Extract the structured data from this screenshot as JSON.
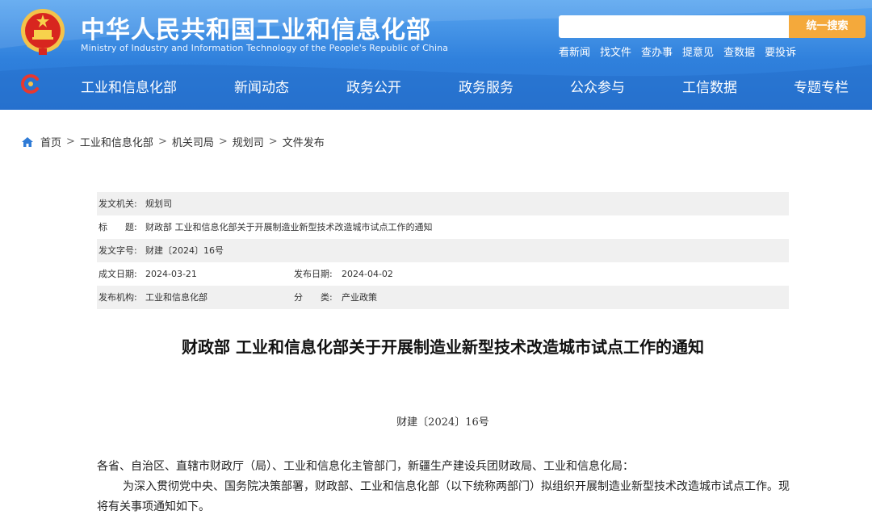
{
  "header": {
    "site_name": "中华人民共和国工业和信息化部",
    "site_name_en": "Ministry of Industry and Information Technology of the People's Republic of China",
    "search_placeholder": "",
    "search_button": "统一搜索",
    "quick_links": [
      "看新闻",
      "找文件",
      "查办事",
      "提意见",
      "查数据",
      "要投诉"
    ],
    "nav": [
      "工业和信息化部",
      "新闻动态",
      "政务公开",
      "政务服务",
      "公众参与",
      "工信数据",
      "专题专栏"
    ]
  },
  "breadcrumb": [
    "首页",
    "工业和信息化部",
    "机关司局",
    "规划司",
    "文件发布"
  ],
  "meta": {
    "issuer_label": "发文机关:",
    "issuer": "规划司",
    "title_label": "标　　题:",
    "title": "财政部 工业和信息化部关于开展制造业新型技术改造城市试点工作的通知",
    "docno_label": "发文字号:",
    "docno": "财建〔2024〕16号",
    "written_label": "成文日期:",
    "written": "2024-03-21",
    "published_label": "发布日期:",
    "published": "2024-04-02",
    "org_label": "发布机构:",
    "org": "工业和信息化部",
    "category_label": "分　　类:",
    "category": "产业政策"
  },
  "doc": {
    "title": "财政部 工业和信息化部关于开展制造业新型技术改造城市试点工作的通知",
    "number": "财建〔2024〕16号",
    "salutation": "各省、自治区、直辖市财政厅（局）、工业和信息化主管部门，新疆生产建设兵团财政局、工业和信息化局：",
    "paragraph1": "为深入贯彻党中央、国务院决策部署，财政部、工业和信息化部（以下统称两部门）拟组织开展制造业新型技术改造城市试点工作。现将有关事项通知如下。"
  },
  "colors": {
    "header_blue": "#2f80dc",
    "search_button": "#f4a93b"
  }
}
